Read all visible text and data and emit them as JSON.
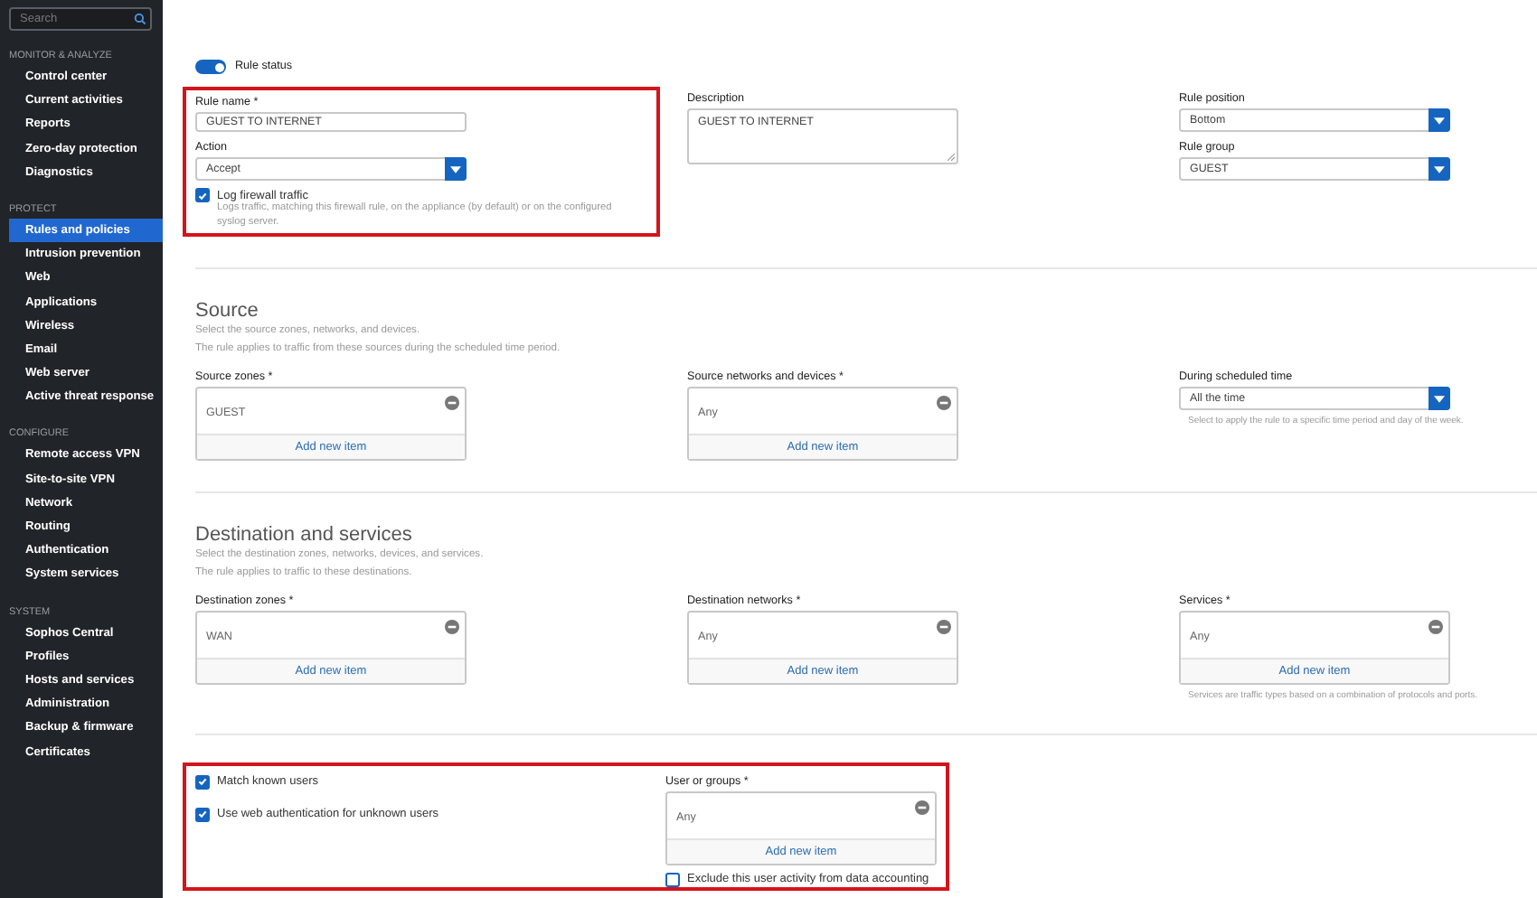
{
  "sidebar": {
    "search": {
      "placeholder": "Search"
    },
    "sections": [
      {
        "title": "MONITOR & ANALYZE",
        "items": [
          {
            "label": "Control center",
            "selected": false
          },
          {
            "label": "Current activities",
            "selected": false
          },
          {
            "label": "Reports",
            "selected": false
          },
          {
            "label": "Zero-day protection",
            "selected": false
          },
          {
            "label": "Diagnostics",
            "selected": false
          }
        ]
      },
      {
        "title": "PROTECT",
        "items": [
          {
            "label": "Rules and policies",
            "selected": true
          },
          {
            "label": "Intrusion prevention",
            "selected": false
          },
          {
            "label": "Web",
            "selected": false
          },
          {
            "label": "Applications",
            "selected": false
          },
          {
            "label": "Wireless",
            "selected": false
          },
          {
            "label": "Email",
            "selected": false
          },
          {
            "label": "Web server",
            "selected": false
          },
          {
            "label": "Active threat response",
            "selected": false
          }
        ]
      },
      {
        "title": "CONFIGURE",
        "items": [
          {
            "label": "Remote access VPN",
            "selected": false
          },
          {
            "label": "Site-to-site VPN",
            "selected": false
          },
          {
            "label": "Network",
            "selected": false
          },
          {
            "label": "Routing",
            "selected": false
          },
          {
            "label": "Authentication",
            "selected": false
          },
          {
            "label": "System services",
            "selected": false
          }
        ]
      },
      {
        "title": "SYSTEM",
        "items": [
          {
            "label": "Sophos Central",
            "selected": false
          },
          {
            "label": "Profiles",
            "selected": false
          },
          {
            "label": "Hosts and services",
            "selected": false
          },
          {
            "label": "Administration",
            "selected": false
          },
          {
            "label": "Backup & firmware",
            "selected": false
          },
          {
            "label": "Certificates",
            "selected": false
          }
        ]
      }
    ]
  },
  "general": {
    "rule_status": {
      "label": "Rule status",
      "on": true
    },
    "highlighted": true,
    "rule_name": {
      "label": "Rule name *",
      "value": "GUEST TO INTERNET"
    },
    "action": {
      "label": "Action",
      "value": "Accept"
    },
    "log_traffic": {
      "label": "Log firewall traffic",
      "checked": true,
      "hint": "Logs traffic, matching this firewall rule, on the appliance (by default) or on the configured syslog server."
    },
    "description": {
      "label": "Description",
      "value": "GUEST TO INTERNET"
    },
    "rule_position": {
      "label": "Rule position",
      "value": "Bottom"
    },
    "rule_group": {
      "label": "Rule group",
      "value": "GUEST"
    }
  },
  "sections": [
    {
      "title": "Source",
      "description": [
        "Select the source zones, networks, and devices.",
        "The rule applies to traffic from these sources during the scheduled time period."
      ],
      "fields": [
        {
          "kind": "list",
          "label": "Source zones *",
          "items": [
            "GUEST"
          ],
          "add": "Add new item"
        },
        {
          "kind": "list",
          "label": "Source networks and devices *",
          "items": [
            "Any"
          ],
          "add": "Add new item"
        },
        {
          "kind": "select",
          "label": "During scheduled time",
          "value": "All the time",
          "hint": "Select to apply the rule to a specific time period and day of the week."
        }
      ]
    },
    {
      "title": "Destination and services",
      "description": [
        "Select the destination zones, networks, devices, and services.",
        "The rule applies to traffic to these destinations."
      ],
      "fields": [
        {
          "kind": "list",
          "label": "Destination zones *",
          "items": [
            "WAN"
          ],
          "add": "Add new item"
        },
        {
          "kind": "list",
          "label": "Destination networks *",
          "items": [
            "Any"
          ],
          "add": "Add new item"
        },
        {
          "kind": "list",
          "label": "Services *",
          "items": [
            "Any"
          ],
          "add": "Add new item",
          "hint": "Services are traffic types based on a combination of protocols and ports."
        }
      ]
    }
  ],
  "users": {
    "highlighted": true,
    "options": [
      {
        "label": "Match known users",
        "checked": true
      },
      {
        "label": "Use web authentication for unknown users",
        "checked": true
      }
    ],
    "user_groups": {
      "label": "User or groups *",
      "items": [
        "Any"
      ],
      "add": "Add new item"
    },
    "exclude": {
      "label": "Exclude this user activity from data accounting",
      "checked": false
    }
  }
}
